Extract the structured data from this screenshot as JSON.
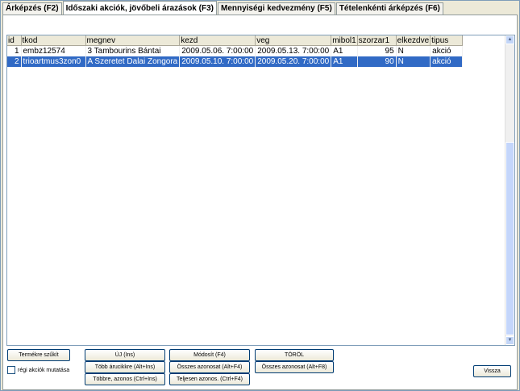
{
  "tabs": [
    {
      "label": "Árképzés (F2)"
    },
    {
      "label": "Időszaki akciók, jövőbeli árazások (F3)"
    },
    {
      "label": "Mennyiségi kedvezmény (F5)"
    },
    {
      "label": "Tételenkénti árképzés (F6)"
    }
  ],
  "grid": {
    "columns": [
      "id",
      "tkod",
      "megnev",
      "kezd",
      "veg",
      "mibol1",
      "szorzar1",
      "elkezdve",
      "tipus"
    ],
    "rows": [
      {
        "id": "1",
        "tkod": "embz12574",
        "megnev": "3 Tambourins Bántai",
        "kezd": "2009.05.06. 7:00:00",
        "veg": "2009.05.13. 7:00:00",
        "mibol1": "A1",
        "szorzar1": "95",
        "elkezdve": "N",
        "tipus": "akció"
      },
      {
        "id": "2",
        "tkod": "trioartmus3zon0",
        "megnev": "A Szeretet Dalai Zongora",
        "kezd": "2009.05.10. 7:00:00",
        "veg": "2009.05.20. 7:00:00",
        "mibol1": "A1",
        "szorzar1": "90",
        "elkezdve": "N",
        "tipus": "akció"
      }
    ]
  },
  "buttons": {
    "narrow": "Termékre szűkít",
    "new": "ÚJ (Ins)",
    "modify": "Módosít (F4)",
    "delete": "TÖRÖL",
    "multi_products": "Több árucikkre (Alt+Ins)",
    "all_same_alt_f4": "Összes azonosat (Alt+F4)",
    "all_same_alt_f8": "Összes azonosat (Alt+F8)",
    "more_same": "Többre, azonos (Ctrl+Ins)",
    "fully_same": "Teljesen azonos. (Ctrl+F4)",
    "back": "Vissza"
  },
  "checkbox": {
    "label": "régi akciók mutatása",
    "checked": false
  }
}
